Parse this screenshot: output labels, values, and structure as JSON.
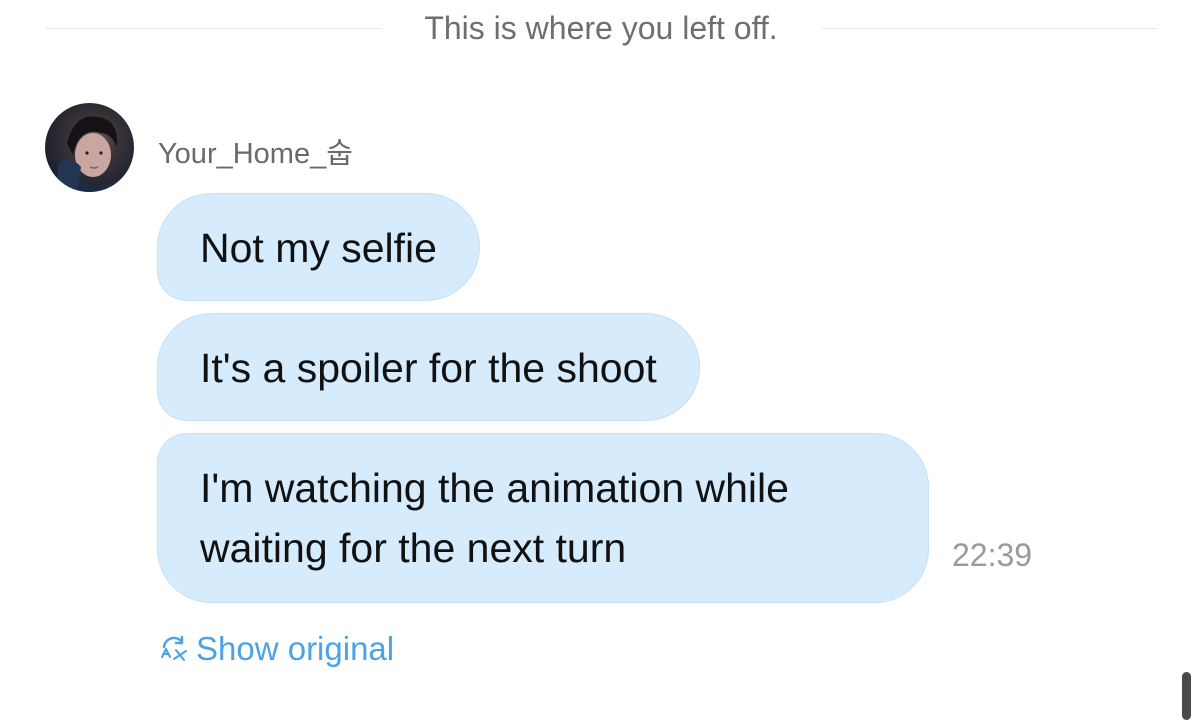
{
  "divider": {
    "text": "This is where you left off."
  },
  "message_group": {
    "sender": {
      "username": "Your_Home_숩",
      "avatar_icon": "profile-photo"
    },
    "messages": [
      {
        "text": "Not my selfie"
      },
      {
        "text": "It's a spoiler for the shoot"
      },
      {
        "text": "I'm watching the animation while waiting for the next turn",
        "time": "22:39"
      }
    ],
    "translation": {
      "icon": "translate-icon",
      "label": "Show original"
    }
  },
  "colors": {
    "bubble_background": "#d6ebfc",
    "link_blue": "#4aa3e8",
    "muted_text": "#6e6e6e"
  }
}
